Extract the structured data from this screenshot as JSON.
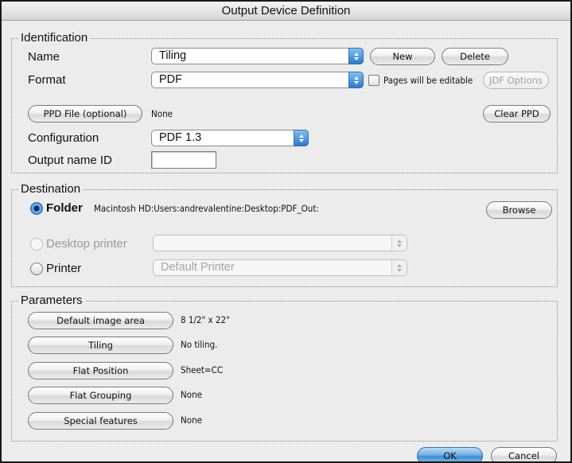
{
  "window": {
    "title": "Output Device Definition"
  },
  "identification": {
    "title": "Identification",
    "name_label": "Name",
    "name_value": "Tiling",
    "new_button": "New",
    "delete_button": "Delete",
    "format_label": "Format",
    "format_value": "PDF",
    "pages_editable_label": "Pages will be editable",
    "pages_editable_checked": false,
    "jdf_options_button": "JDF Options",
    "ppd_button": "PPD File (optional)",
    "ppd_value": "None",
    "clear_ppd_button": "Clear PPD",
    "configuration_label": "Configuration",
    "configuration_value": "PDF 1.3",
    "output_name_label": "Output name ID",
    "output_name_value": ""
  },
  "destination": {
    "title": "Destination",
    "selected": "Folder",
    "folder_label": "Folder",
    "folder_path": "Macintosh HD:Users:andrevalentine:Desktop:PDF_Out:",
    "browse_button": "Browse",
    "desktop_printer_label": "Desktop printer",
    "desktop_printer_value": "",
    "printer_label": "Printer",
    "printer_value": "Default Printer"
  },
  "parameters": {
    "title": "Parameters",
    "rows": [
      {
        "button": "Default image area",
        "value": "8 1/2\" x 22\""
      },
      {
        "button": "Tiling",
        "value": "No tiling."
      },
      {
        "button": "Flat Position",
        "value": "Sheet=CC"
      },
      {
        "button": "Flat Grouping",
        "value": "None"
      },
      {
        "button": "Special features",
        "value": "None"
      }
    ]
  },
  "footer": {
    "ok_button": "OK",
    "cancel_button": "Cancel"
  },
  "colors": {
    "accent": "#3f8bd4",
    "window_bg": "#ececec",
    "disabled_text": "#9a9a9a"
  }
}
